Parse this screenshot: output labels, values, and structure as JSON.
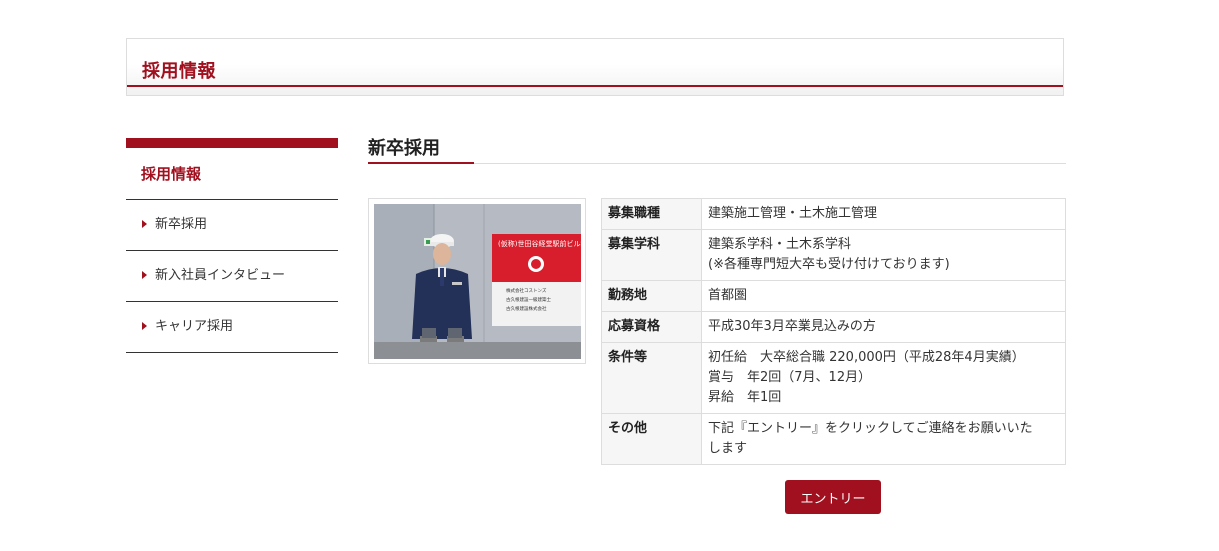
{
  "header": {
    "title": "採用情報"
  },
  "sidebar": {
    "title": "採用情報",
    "items": [
      {
        "label": "新卒採用"
      },
      {
        "label": "新入社員インタビュー"
      },
      {
        "label": "キャリア採用"
      }
    ]
  },
  "main": {
    "section_title": "新卒採用",
    "photo": {
      "sign_title": "(仮称)世田谷経堂駅前ビル新",
      "sign_lines": [
        "株式会社コストンズ",
        "古久根建設一級建築士",
        "古久根建設株式会社"
      ]
    },
    "table": [
      {
        "label": "募集職種",
        "lines": [
          "建築施工管理・土木施工管理"
        ]
      },
      {
        "label": "募集学科",
        "lines": [
          "建築系学科・土木系学科",
          "(※各種専門短大卒も受け付けております)"
        ]
      },
      {
        "label": "勤務地",
        "lines": [
          "首都圏"
        ]
      },
      {
        "label": "応募資格",
        "lines": [
          "平成30年3月卒業見込みの方"
        ]
      },
      {
        "label": "条件等",
        "lines": [
          "初任給　大卒総合職 220,000円（平成28年4月実績）",
          "賞与　年2回（7月、12月）",
          "昇給　年1回"
        ]
      },
      {
        "label": "その他",
        "lines": [
          "下記『エントリー』をクリックしてご連絡をお願いいた",
          "します"
        ]
      }
    ],
    "entry_button": "エントリー"
  },
  "colors": {
    "accent": "#a0101f",
    "border": "#dddddd",
    "label_bg": "#f6f6f6"
  }
}
